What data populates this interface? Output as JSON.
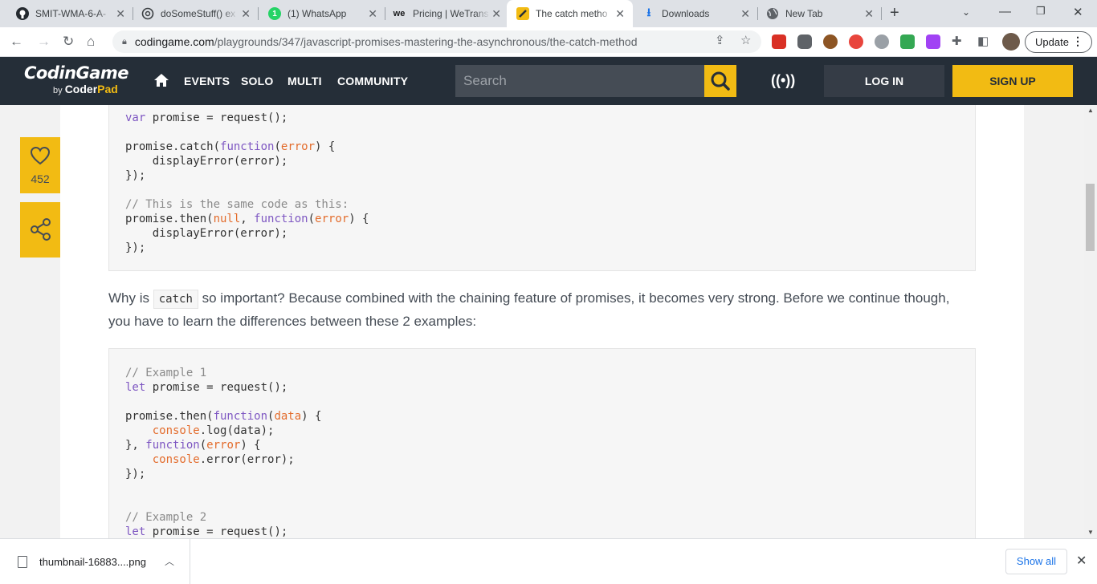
{
  "browser": {
    "tabs": [
      {
        "title": "SMIT-WMA-6-A-",
        "icon": "github-icon"
      },
      {
        "title": "doSomeStuff() ex",
        "icon": "chatgpt-icon"
      },
      {
        "title": "(1) WhatsApp",
        "icon": "whatsapp-icon"
      },
      {
        "title": "Pricing | WeTrans",
        "icon": "wetransfer-icon"
      },
      {
        "title": "The catch metho",
        "icon": "codingame-icon",
        "active": true
      },
      {
        "title": "Downloads",
        "icon": "download-icon"
      },
      {
        "title": "New Tab",
        "icon": "globe-icon"
      }
    ],
    "url_host": "codingame.com",
    "url_path": "/playgrounds/347/javascript-promises-mastering-the-asynchronous/the-catch-method",
    "update_label": "Update"
  },
  "header": {
    "logo_main": "CodinGame",
    "logo_by": "by",
    "logo_coder": "Coder",
    "logo_pad": "Pad",
    "nav": [
      "EVENTS",
      "SOLO",
      "MULTI",
      "COMMUNITY"
    ],
    "search_placeholder": "Search",
    "login_label": "LOG IN",
    "signup_label": "SIGN UP",
    "accent": "#f2bb13"
  },
  "sidebar": {
    "like_count": "452"
  },
  "article": {
    "paragraph_before_code": "Why is",
    "paragraph_code": "catch",
    "paragraph_after_code": "so important? Because combined with the chaining feature of promises, it becomes very strong. Before we continue though, you have to learn the differences between these 2 examples:"
  },
  "downloads": {
    "file_name": "thumbnail-16883....png",
    "show_all_label": "Show all"
  }
}
